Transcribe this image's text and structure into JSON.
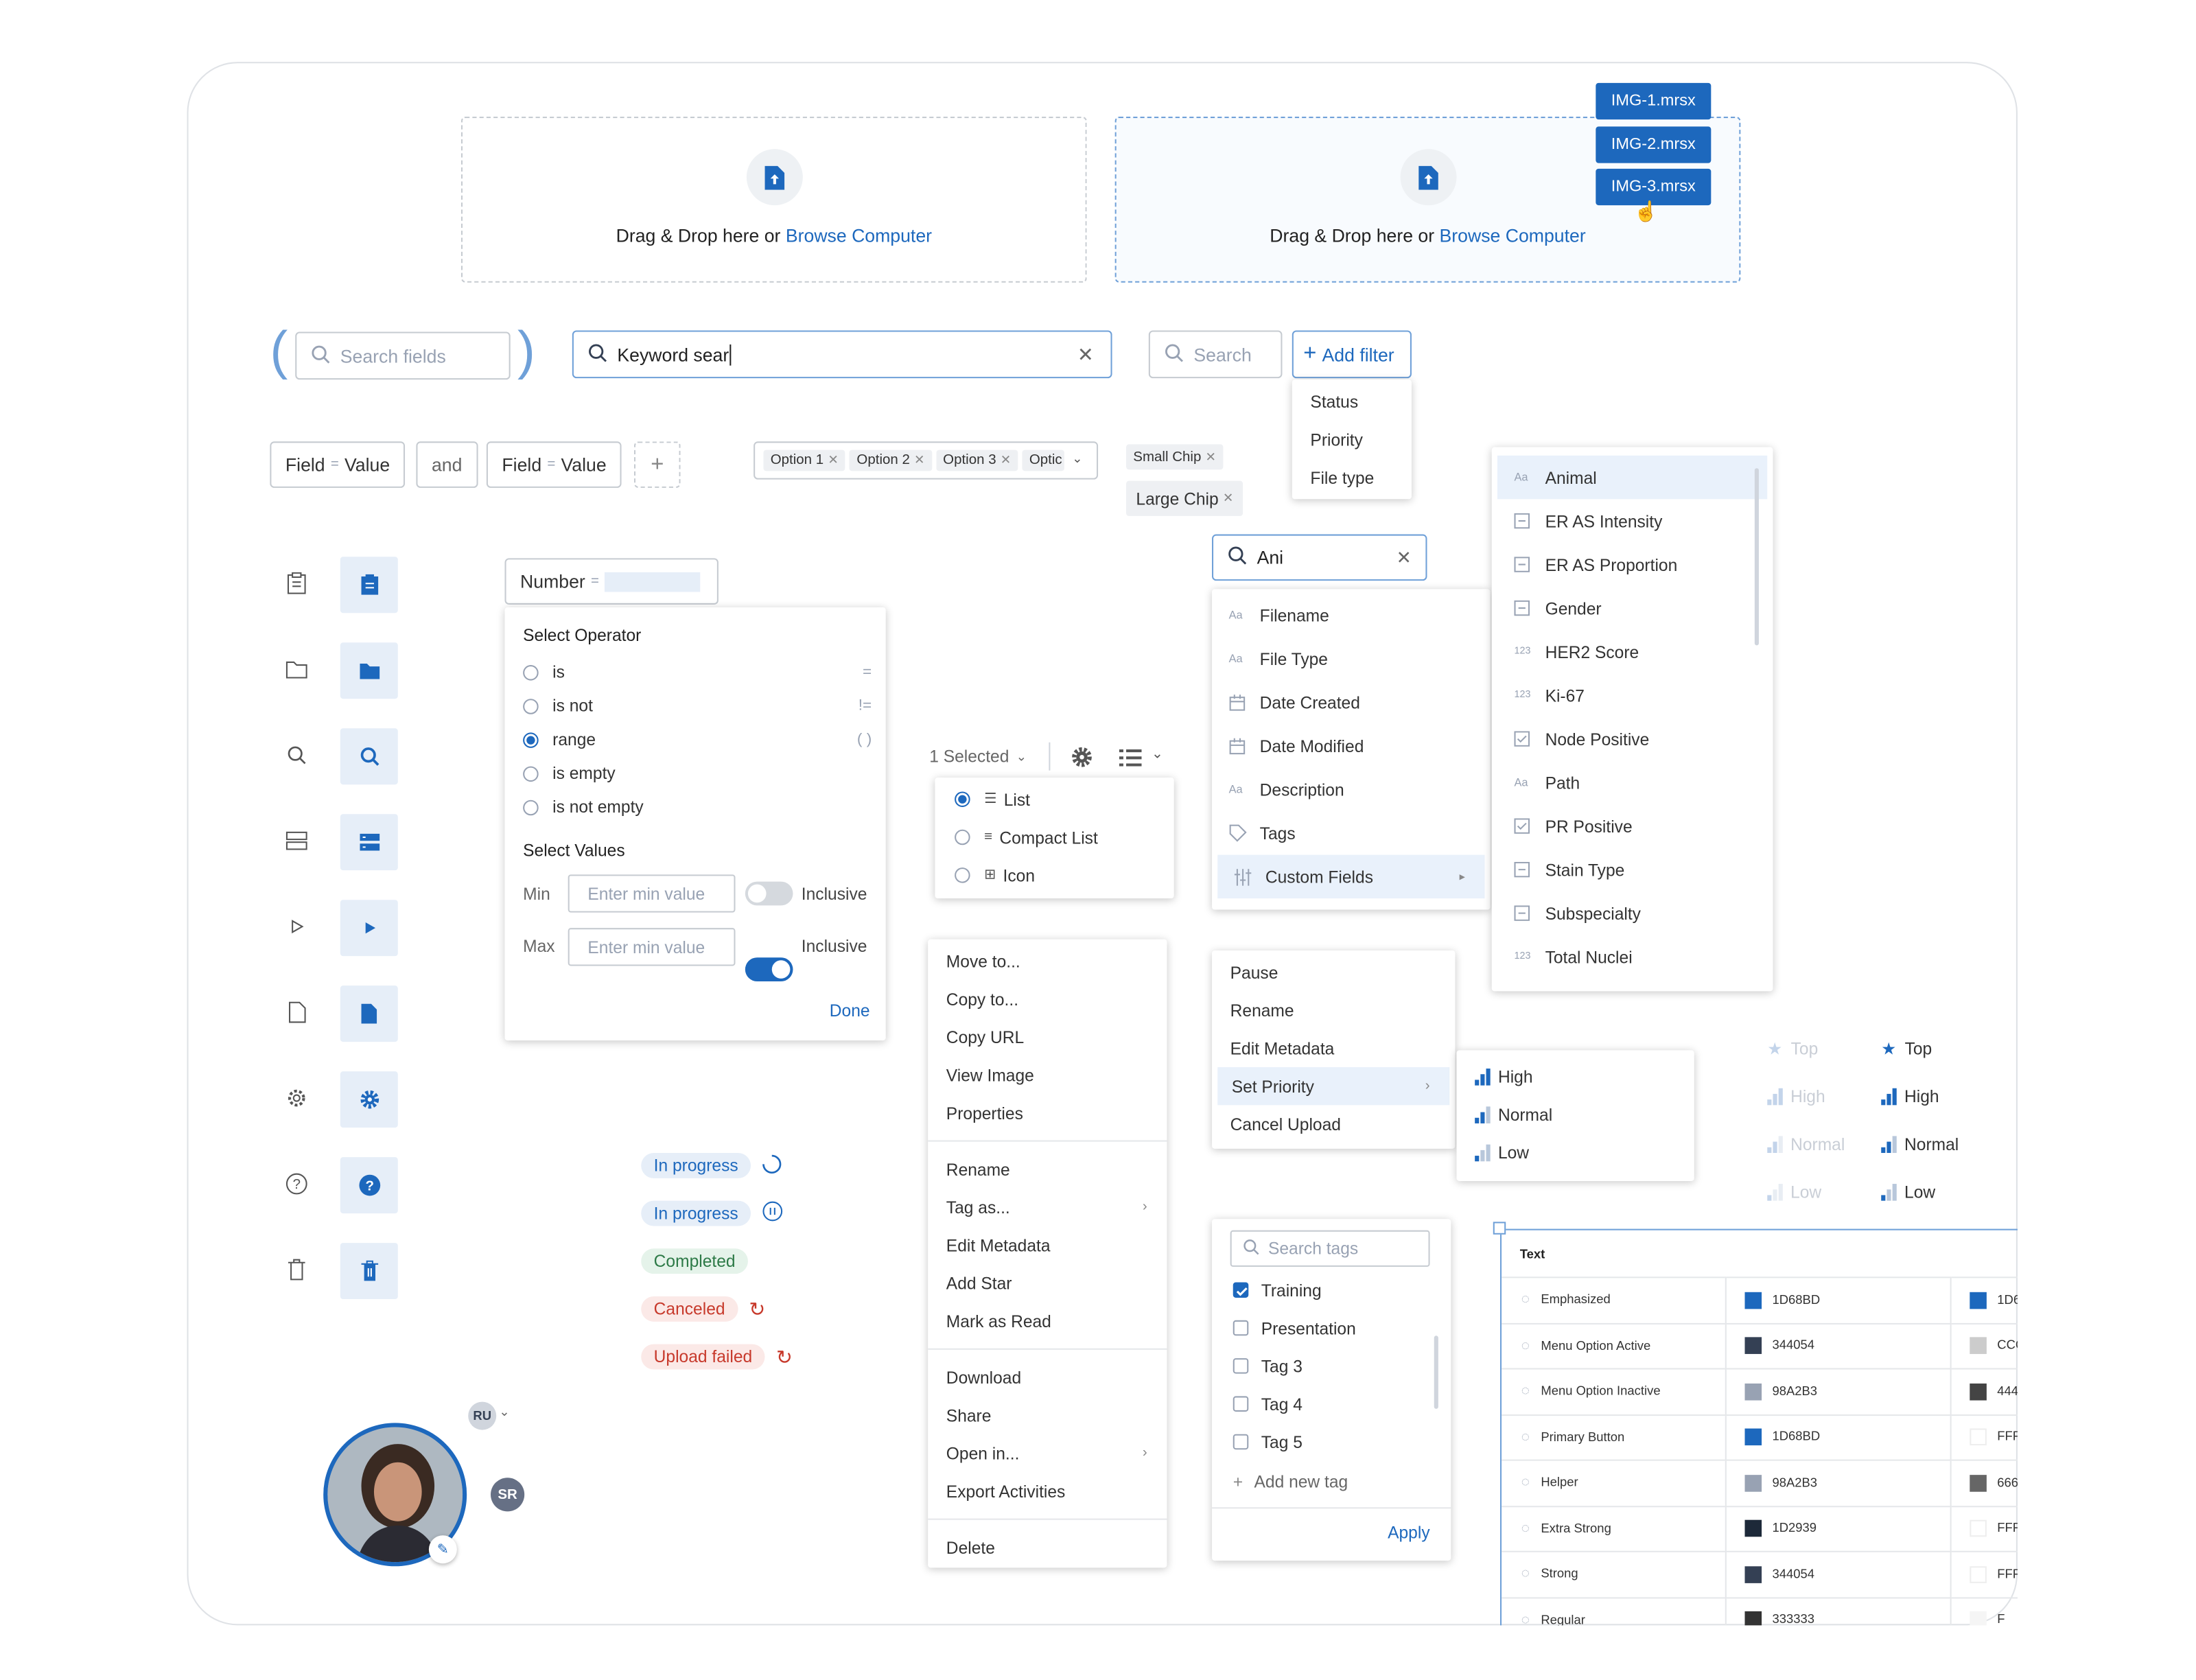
{
  "upload": {
    "drop_text": "Drag & Drop here or",
    "browse_link": "Browse Computer",
    "files": [
      "IMG-1.mrsx",
      "IMG-2.mrsx",
      "IMG-3.mrsx"
    ]
  },
  "search": {
    "fields_placeholder": "Search fields",
    "keyword_value": "Keyword sear",
    "search_placeholder": "Search",
    "add_filter": "Add filter",
    "filter_menu": [
      "Status",
      "Priority",
      "File type"
    ]
  },
  "query": {
    "field1": "Field",
    "eq1": "=",
    "value1": "Value",
    "connector": "and",
    "field2": "Field",
    "eq2": "=",
    "value2": "Value"
  },
  "multiselect": {
    "options": [
      "Option 1",
      "Option 2",
      "Option 3",
      "Optic"
    ]
  },
  "chips": {
    "small": "Small Chip",
    "large": "Large Chip"
  },
  "number_filter": {
    "field": "Number",
    "eq": "=",
    "select_operator": "Select Operator",
    "operators": [
      {
        "label": "is",
        "sym": "="
      },
      {
        "label": "is not",
        "sym": "!="
      },
      {
        "label": "range",
        "sym": "( )"
      },
      {
        "label": "is empty",
        "sym": ""
      },
      {
        "label": "is not empty",
        "sym": ""
      }
    ],
    "select_values": "Select Values",
    "min_label": "Min",
    "max_label": "Max",
    "min_placeholder": "Enter min value",
    "max_placeholder": "Enter min value",
    "inclusive": "Inclusive",
    "done": "Done"
  },
  "view": {
    "selected": "1 Selected",
    "options": [
      "List",
      "Compact List",
      "Icon"
    ]
  },
  "field_search": {
    "value": "Ani",
    "items": [
      "Filename",
      "File Type",
      "Date Created",
      "Date Modified",
      "Description",
      "Tags",
      "Custom Fields"
    ]
  },
  "custom_fields": [
    "Animal",
    "ER AS Intensity",
    "ER AS Proportion",
    "Gender",
    "HER2 Score",
    "Ki-67",
    "Node Positive",
    "Path",
    "PR Positive",
    "Stain Type",
    "Subspecialty",
    "Total Nuclei"
  ],
  "context_menu": {
    "group1": [
      "Move to...",
      "Copy to...",
      "Copy URL",
      "View Image",
      "Properties"
    ],
    "group2": [
      "Rename",
      "Tag as...",
      "Edit Metadata",
      "Add Star",
      "Mark as Read"
    ],
    "group3": [
      "Download",
      "Share",
      "Open in...",
      "Export Activities"
    ],
    "group4": [
      "Delete"
    ]
  },
  "upload_menu": {
    "items": [
      "Pause",
      "Rename",
      "Edit Metadata",
      "Set Priority",
      "Cancel Upload"
    ],
    "priority": [
      "High",
      "Normal",
      "Low"
    ]
  },
  "priority_icons": {
    "labels": [
      "Top",
      "High",
      "Normal",
      "Low"
    ]
  },
  "status": {
    "in_progress": "In progress",
    "completed": "Completed",
    "canceled": "Canceled",
    "upload_failed": "Upload failed"
  },
  "tags": {
    "placeholder": "Search tags",
    "items": [
      "Training",
      "Presentation",
      "Tag 3",
      "Tag 4",
      "Tag 5"
    ],
    "add_new": "Add new tag",
    "apply": "Apply"
  },
  "avatar": {
    "initials_ru": "RU",
    "initials_sr": "SR"
  },
  "colors_table": {
    "header": "Text",
    "rows": [
      {
        "name": "Emphasized",
        "hex": "1D68BD",
        "color": "#1d68bd",
        "alt": "1D6",
        "altc": "#1d68bd"
      },
      {
        "name": "Menu Option Active",
        "hex": "344054",
        "color": "#344054",
        "alt": "CCC",
        "altc": "#cccccc"
      },
      {
        "name": "Menu Option Inactive",
        "hex": "98A2B3",
        "color": "#98a2b3",
        "alt": "444",
        "altc": "#444444"
      },
      {
        "name": "Primary Button",
        "hex": "1D68BD",
        "color": "#1d68bd",
        "alt": "FFF",
        "altc": "#ffffff"
      },
      {
        "name": "Helper",
        "hex": "98A2B3",
        "color": "#98a2b3",
        "alt": "666",
        "altc": "#666666"
      },
      {
        "name": "Extra Strong",
        "hex": "1D2939",
        "color": "#1d2939",
        "alt": "FFF",
        "altc": "#ffffff"
      },
      {
        "name": "Strong",
        "hex": "344054",
        "color": "#344054",
        "alt": "FFF",
        "altc": "#ffffff"
      },
      {
        "name": "Regular",
        "hex": "333333",
        "color": "#333333",
        "alt": "F",
        "altc": "#f5f5f5"
      }
    ]
  },
  "accent": "#1D68BD"
}
